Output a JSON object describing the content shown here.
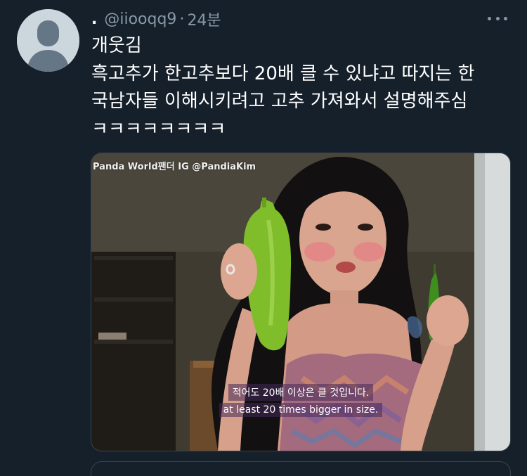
{
  "tweet": {
    "display_name": ".",
    "handle": "@iiooqq9",
    "separator": "·",
    "time": "24분",
    "text_lines": [
      "개웃김",
      "흑고추가 한고추보다 20배 클 수 있냐고 따지는 한",
      "국남자들 이해시키려고 고추 가져와서 설명해주심",
      "ㅋㅋㅋㅋㅋㅋㅋㅋ"
    ]
  },
  "media": {
    "watermark": "Panda World팬더  IG @PandiaKim",
    "subtitle_ko": "적어도 20배 이상은 클 것입니다.",
    "subtitle_en": "at least 20 times bigger in size."
  },
  "icons": {
    "avatar": "default-avatar-icon",
    "more": "more-horizontal-icon"
  },
  "colors": {
    "background": "#15202b",
    "secondary_text": "#8899a6",
    "border": "#38444d"
  }
}
